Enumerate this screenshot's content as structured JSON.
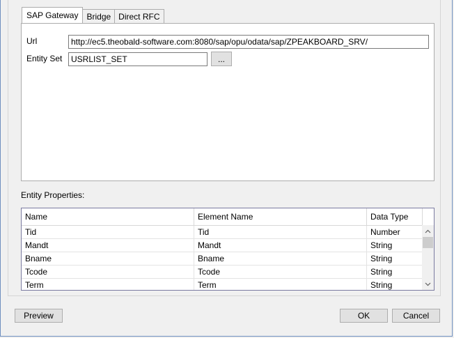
{
  "tabs": [
    {
      "label": "SAP Gateway",
      "active": true
    },
    {
      "label": "Bridge",
      "active": false
    },
    {
      "label": "Direct RFC",
      "active": false
    }
  ],
  "form": {
    "url_label": "Url",
    "url_value": "http://ec5.theobald-software.com:8080/sap/opu/odata/sap/ZPEAKBOARD_SRV/",
    "entity_set_label": "Entity Set",
    "entity_set_value": "USRLIST_SET",
    "browse_label": "..."
  },
  "properties": {
    "title": "Entity Properties:",
    "columns": [
      "Name",
      "Element Name",
      "Data Type"
    ],
    "rows": [
      {
        "name": "Tid",
        "element": "Tid",
        "type": "Number"
      },
      {
        "name": "Mandt",
        "element": "Mandt",
        "type": "String"
      },
      {
        "name": "Bname",
        "element": "Bname",
        "type": "String"
      },
      {
        "name": "Tcode",
        "element": "Tcode",
        "type": "String"
      },
      {
        "name": "Term",
        "element": "Term",
        "type": "String"
      }
    ]
  },
  "buttons": {
    "preview": "Preview",
    "ok": "OK",
    "cancel": "Cancel"
  },
  "icons": {
    "scroll_up": "chevron-up-icon",
    "scroll_down": "chevron-down-icon"
  }
}
